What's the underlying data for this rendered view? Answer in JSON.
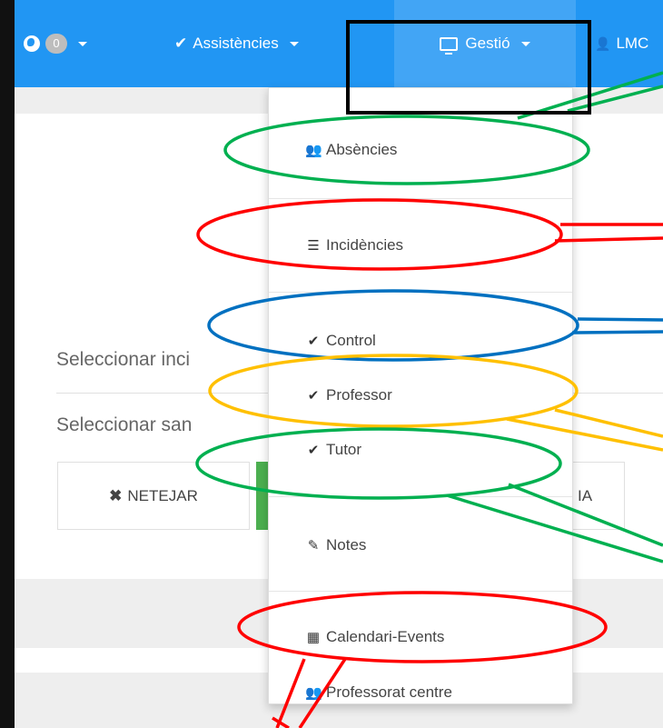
{
  "navbar": {
    "badge_count": "0",
    "assistencies_label": "Assistències",
    "gestio_label": "Gestió",
    "user_label": "LMC"
  },
  "content": {
    "select_incidence_label": "Seleccionar inci",
    "select_sanction_label": "Seleccionar san",
    "clear_button_label": "NETEJAR",
    "right_button_partial_label": "IA"
  },
  "dropdown": {
    "items": [
      {
        "label": "Absències",
        "icon": "users-icon"
      },
      {
        "label": "Incidències",
        "icon": "list-icon"
      },
      {
        "label": "Control",
        "icon": "check-icon"
      },
      {
        "label": "Professor",
        "icon": "check-icon"
      },
      {
        "label": "Tutor",
        "icon": "check-icon"
      },
      {
        "label": "Notes",
        "icon": "edit-icon"
      },
      {
        "label": "Calendari-Events",
        "icon": "grid-icon"
      },
      {
        "label": "Professorat centre",
        "icon": "group-icon"
      }
    ]
  },
  "colors": {
    "navbar": "#2196f3",
    "navbar_active": "#42a5f5",
    "annotation_green": "#00b050",
    "annotation_red": "#ff0000",
    "annotation_blue": "#0070c0",
    "annotation_yellow": "#ffc000",
    "success_green": "#4caf50"
  }
}
